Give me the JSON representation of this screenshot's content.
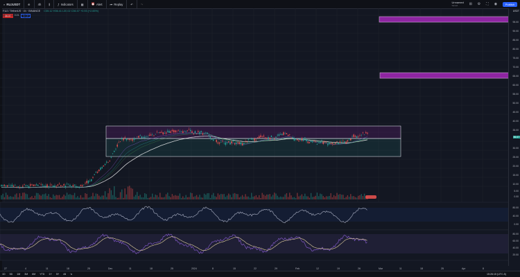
{
  "toolbar": {
    "symbol": "RUJUSDT",
    "interval": "4h",
    "indicators_label": "Indicators",
    "alert_label": "Alert",
    "replay_label": "Replay",
    "saved_title": "Unnamed",
    "saved_sub": "Saved",
    "publish_label": "Publish"
  },
  "legend": {
    "title": "RUJ / TetherUS · 4h · BINANCE",
    "ohlc": "O35.12 H36.41 L35.02 C36.07 +0.93 (+2.65%)",
    "bid": "36.07",
    "spread": "0.01",
    "ask": "36.08"
  },
  "price_axis": {
    "currency": "USDT",
    "current": "36.07",
    "ticks": [
      "95.00",
      "90.00",
      "85.00",
      "80.00",
      "75.00",
      "70.00",
      "65.00",
      "60.00",
      "55.00",
      "50.00",
      "45.00",
      "40.00",
      "35.00",
      "30.00",
      "25.00",
      "20.00",
      "15.00",
      "10.00",
      "5.00",
      "0.00"
    ]
  },
  "indicator_axis_ticks": [
    "80.00",
    "40.00",
    "0.00",
    "80.00",
    "60.00",
    "40.00",
    "20.00"
  ],
  "date_axis": [
    "27",
    "4",
    "11",
    "18",
    "25",
    "Dec",
    "11",
    "18",
    "25",
    "2024",
    "8",
    "15",
    "22",
    "29",
    "Feb",
    "12",
    "19",
    "26",
    "Mar",
    "11",
    "18",
    "25",
    "Apr",
    "8"
  ],
  "timeframes": [
    "1D",
    "5D",
    "1M",
    "3M",
    "6M",
    "YTD",
    "1Y",
    "5Y",
    "All"
  ],
  "clock": "15:26:15 (UTC-5)",
  "colors": {
    "up": "#26a69a",
    "down": "#ef5350",
    "zone": "#9c27b0",
    "range_box": "#b2b5be",
    "oscillator": "#7e57c2",
    "signal": "#e8d6a0"
  },
  "icons": [
    "search-icon",
    "plus-icon",
    "indicators-icon",
    "grid-icon",
    "alert-icon",
    "replay-icon",
    "undo-icon",
    "redo-icon",
    "fullscreen-icon",
    "camera-icon",
    "settings-icon"
  ]
}
